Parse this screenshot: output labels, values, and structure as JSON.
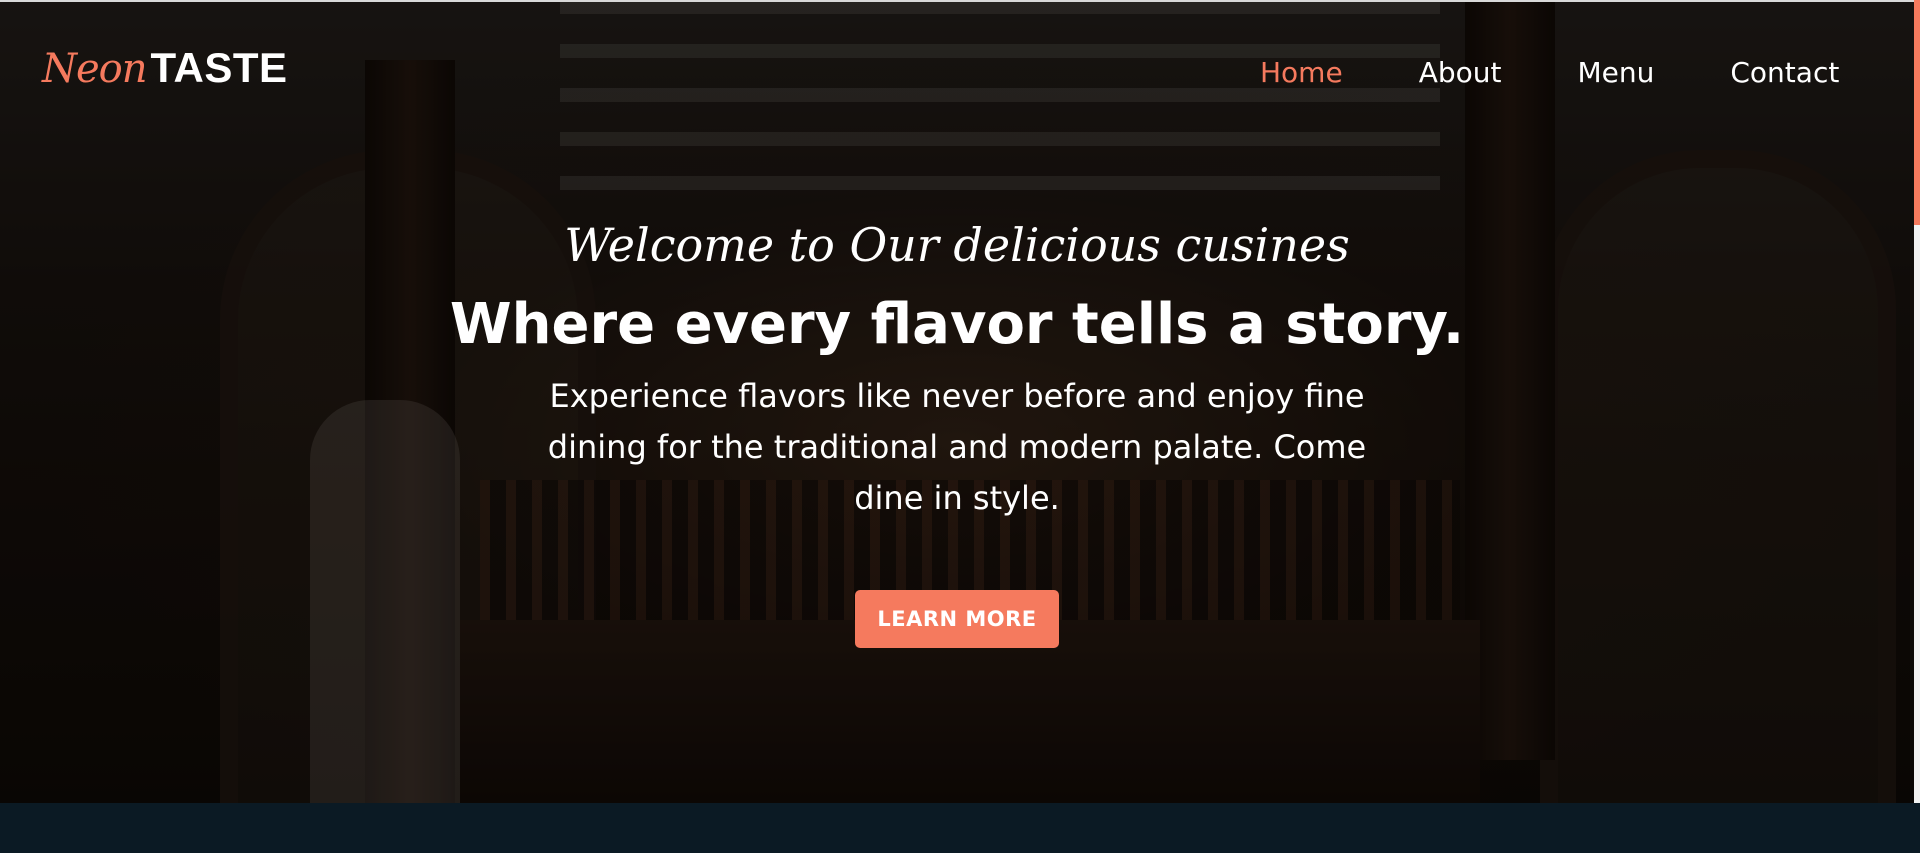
{
  "brand": {
    "logo_script": "Neon",
    "logo_main": "TASTE"
  },
  "nav": {
    "items": [
      {
        "label": "Home",
        "active": true
      },
      {
        "label": "About",
        "active": false
      },
      {
        "label": "Menu",
        "active": false
      },
      {
        "label": "Contact",
        "active": false
      }
    ]
  },
  "hero": {
    "welcome": "Welcome to Our delicious cusines",
    "headline": "Where every flavor tells a story.",
    "subtext": "Experience flavors like never before and enjoy fine dining for the traditional and modern palate. Come dine in style.",
    "cta_label": "LEARN MORE"
  },
  "colors": {
    "accent": "#f57a5e",
    "text": "#ffffff",
    "footer_band": "#0b1a24"
  }
}
